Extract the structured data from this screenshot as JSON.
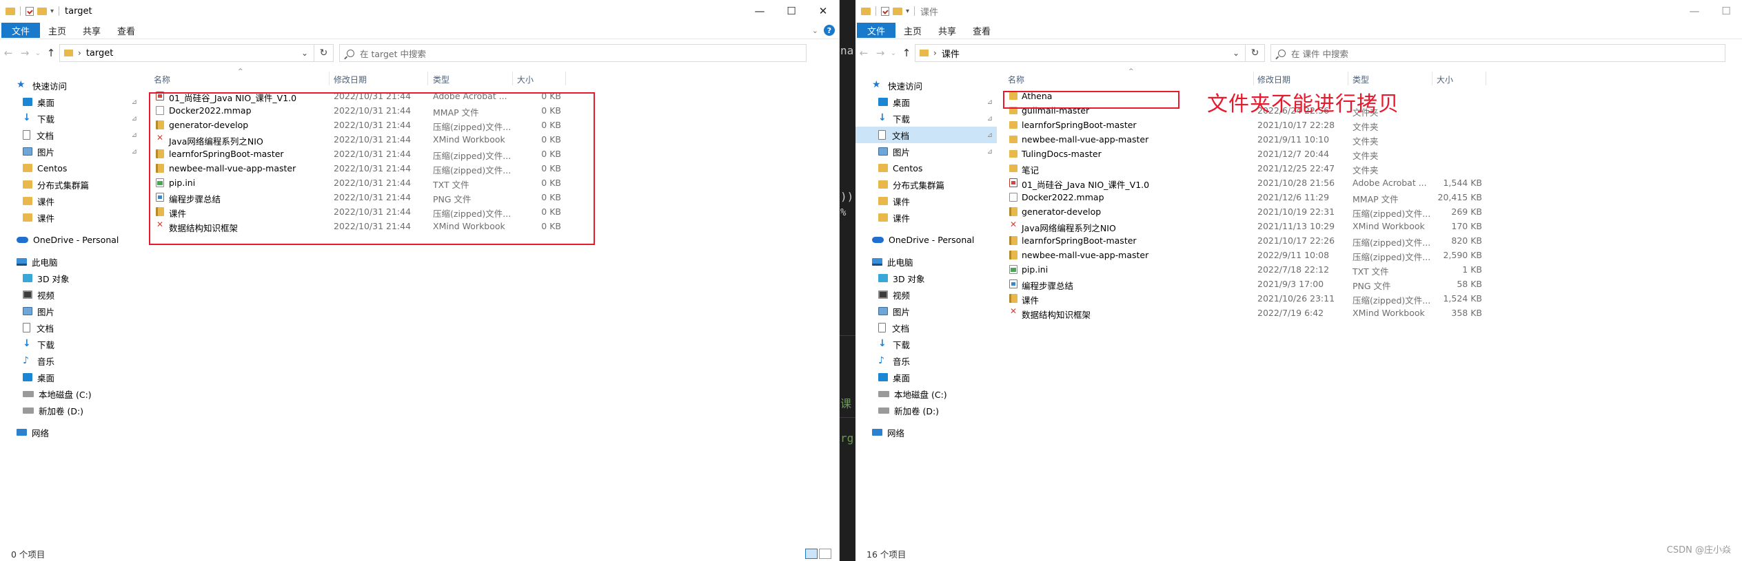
{
  "ribbon": {
    "file": "文件",
    "home": "主页",
    "share": "共享",
    "view": "查看"
  },
  "left": {
    "title": "target",
    "address": "target",
    "search_placeholder": "在 target 中搜索",
    "status": "0 个项目",
    "columns": {
      "name": "名称",
      "date": "修改日期",
      "type": "类型",
      "size": "大小"
    },
    "files": [
      {
        "name": "01_尚硅谷_Java NIO_课件_V1.0",
        "date": "2022/10/31 21:44",
        "type": "Adobe Acrobat ...",
        "size": "0 KB",
        "icon": "pdf-icon"
      },
      {
        "name": "Docker2022.mmap",
        "date": "2022/10/31 21:44",
        "type": "MMAP 文件",
        "size": "0 KB",
        "icon": "mmap-icon"
      },
      {
        "name": "generator-develop",
        "date": "2022/10/31 21:44",
        "type": "压缩(zipped)文件...",
        "size": "0 KB",
        "icon": "zip-icon"
      },
      {
        "name": "Java网络编程系列之NIO",
        "date": "2022/10/31 21:44",
        "type": "XMind Workbook",
        "size": "0 KB",
        "icon": "xmind-icon"
      },
      {
        "name": "learnforSpringBoot-master",
        "date": "2022/10/31 21:44",
        "type": "压缩(zipped)文件...",
        "size": "0 KB",
        "icon": "zip-icon"
      },
      {
        "name": "newbee-mall-vue-app-master",
        "date": "2022/10/31 21:44",
        "type": "压缩(zipped)文件...",
        "size": "0 KB",
        "icon": "zip-icon"
      },
      {
        "name": "pip.ini",
        "date": "2022/10/31 21:44",
        "type": "TXT 文件",
        "size": "0 KB",
        "icon": "txt-icon"
      },
      {
        "name": "编程步骤总结",
        "date": "2022/10/31 21:44",
        "type": "PNG 文件",
        "size": "0 KB",
        "icon": "png-icon"
      },
      {
        "name": "课件",
        "date": "2022/10/31 21:44",
        "type": "压缩(zipped)文件...",
        "size": "0 KB",
        "icon": "zip-icon"
      },
      {
        "name": "数据结构知识框架",
        "date": "2022/10/31 21:44",
        "type": "XMind Workbook",
        "size": "0 KB",
        "icon": "xmind-icon"
      }
    ]
  },
  "right": {
    "title": "课件",
    "address": "课件",
    "search_placeholder": "在 课件 中搜索",
    "status": "16 个项目",
    "columns": {
      "name": "名称",
      "date": "修改日期",
      "type": "类型",
      "size": "大小"
    },
    "annotation": "文件夹不能进行拷贝",
    "files": [
      {
        "name": "Athena",
        "date": "",
        "type": "",
        "size": "",
        "icon": "folder-icon"
      },
      {
        "name": "gulimall-master",
        "date": "2022/6/24 22:56",
        "type": "文件夹",
        "size": "",
        "icon": "folder-icon"
      },
      {
        "name": "learnforSpringBoot-master",
        "date": "2021/10/17 22:28",
        "type": "文件夹",
        "size": "",
        "icon": "folder-icon"
      },
      {
        "name": "newbee-mall-vue-app-master",
        "date": "2021/9/11 10:10",
        "type": "文件夹",
        "size": "",
        "icon": "folder-icon"
      },
      {
        "name": "TulingDocs-master",
        "date": "2021/12/7 20:44",
        "type": "文件夹",
        "size": "",
        "icon": "folder-icon"
      },
      {
        "name": "笔记",
        "date": "2021/12/25 22:47",
        "type": "文件夹",
        "size": "",
        "icon": "folder-icon"
      },
      {
        "name": "01_尚硅谷_Java NIO_课件_V1.0",
        "date": "2021/10/28 21:56",
        "type": "Adobe Acrobat ...",
        "size": "1,544 KB",
        "icon": "pdf-icon"
      },
      {
        "name": "Docker2022.mmap",
        "date": "2021/12/6 11:29",
        "type": "MMAP 文件",
        "size": "20,415 KB",
        "icon": "mmap-icon"
      },
      {
        "name": "generator-develop",
        "date": "2021/10/19 22:31",
        "type": "压缩(zipped)文件...",
        "size": "269 KB",
        "icon": "zip-icon"
      },
      {
        "name": "Java网络编程系列之NIO",
        "date": "2021/11/13 10:29",
        "type": "XMind Workbook",
        "size": "170 KB",
        "icon": "xmind-icon"
      },
      {
        "name": "learnforSpringBoot-master",
        "date": "2021/10/17 22:26",
        "type": "压缩(zipped)文件...",
        "size": "820 KB",
        "icon": "zip-icon"
      },
      {
        "name": "newbee-mall-vue-app-master",
        "date": "2022/9/11 10:08",
        "type": "压缩(zipped)文件...",
        "size": "2,590 KB",
        "icon": "zip-icon"
      },
      {
        "name": "pip.ini",
        "date": "2022/7/18 22:12",
        "type": "TXT 文件",
        "size": "1 KB",
        "icon": "txt-icon"
      },
      {
        "name": "编程步骤总结",
        "date": "2021/9/3 17:00",
        "type": "PNG 文件",
        "size": "58 KB",
        "icon": "png-icon"
      },
      {
        "name": "课件",
        "date": "2021/10/26 23:11",
        "type": "压缩(zipped)文件...",
        "size": "1,524 KB",
        "icon": "zip-icon"
      },
      {
        "name": "数据结构知识框架",
        "date": "2022/7/19 6:42",
        "type": "XMind Workbook",
        "size": "358 KB",
        "icon": "xmind-icon"
      }
    ]
  },
  "sidebar": [
    {
      "label": "快速访问",
      "icon": "star-icon",
      "pinned": false
    },
    {
      "label": "桌面",
      "icon": "desktop-icon",
      "pinned": true
    },
    {
      "label": "下载",
      "icon": "download-icon",
      "pinned": true
    },
    {
      "label": "文档",
      "icon": "documents-icon",
      "pinned": true
    },
    {
      "label": "图片",
      "icon": "pictures-icon",
      "pinned": true
    },
    {
      "label": "Centos",
      "icon": "folder-icon",
      "pinned": false
    },
    {
      "label": "分布式集群篇",
      "icon": "folder-icon",
      "pinned": false
    },
    {
      "label": "课件",
      "icon": "folder-icon",
      "pinned": false
    },
    {
      "label": "课件",
      "icon": "folder-icon",
      "pinned": false
    },
    {
      "label": "OneDrive - Personal",
      "icon": "onedrive-icon",
      "pinned": false
    },
    {
      "label": "此电脑",
      "icon": "this-pc-icon",
      "pinned": false
    },
    {
      "label": "3D 对象",
      "icon": "3d-objects-icon",
      "pinned": false
    },
    {
      "label": "视频",
      "icon": "videos-icon",
      "pinned": false
    },
    {
      "label": "图片",
      "icon": "pictures-icon",
      "pinned": false
    },
    {
      "label": "文档",
      "icon": "documents-icon",
      "pinned": false
    },
    {
      "label": "下载",
      "icon": "download-icon",
      "pinned": false
    },
    {
      "label": "音乐",
      "icon": "music-icon",
      "pinned": false
    },
    {
      "label": "桌面",
      "icon": "desktop-icon",
      "pinned": false
    },
    {
      "label": "本地磁盘 (C:)",
      "icon": "drive-icon",
      "pinned": false
    },
    {
      "label": "新加卷 (D:)",
      "icon": "drive-icon",
      "pinned": false
    },
    {
      "label": "网络",
      "icon": "network-icon",
      "pinned": false
    }
  ],
  "strip_glyphs": [
    "na",
    "))",
    "%",
    "课",
    "rg"
  ],
  "watermark": "CSDN @庄小焱",
  "colors": {
    "accent": "#1979ca",
    "annotation": "#e8192c",
    "selection": "#cce4f7",
    "folder": "#e9b84a"
  }
}
